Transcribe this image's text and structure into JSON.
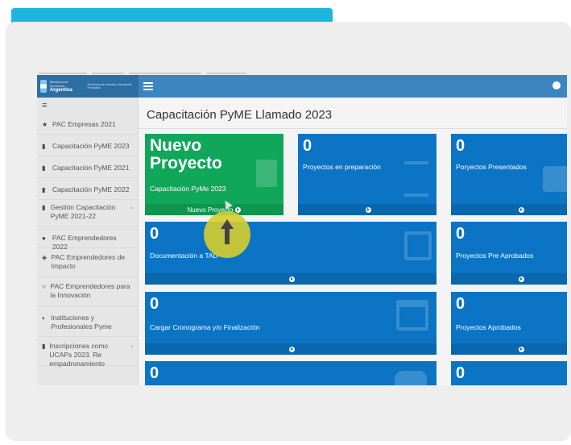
{
  "header": {
    "brand_line1": "Ministerio de Economía",
    "brand_line2": "Argentina",
    "brand_sub": "Secretaría de Industria y Desarrollo Productivo"
  },
  "sidebar": {
    "toggle": "≡",
    "items": [
      {
        "icon": "★",
        "label": "PAC Empresas 2021"
      },
      {
        "icon": "▮",
        "label": "Capacitación PyME 2023"
      },
      {
        "icon": "▮",
        "label": "Capacitación PyME 2021"
      },
      {
        "icon": "▮",
        "label": "Capacitación PyME 2022"
      },
      {
        "icon": "▮",
        "label": "Gestión Capacitación PyME 2021-22"
      },
      {
        "icon": "●",
        "label": "PAC Emprendedores 2022"
      },
      {
        "icon": "◈",
        "label": "PAC Emprendedores de Impacto"
      },
      {
        "icon": "○",
        "label": "PAC Emprendedores para la Innovación"
      },
      {
        "icon": "◐",
        "label": "Instituciones y Profesionales Pyme"
      },
      {
        "icon": "▮",
        "label": "Inscripciones como UCAPs 2023. Re empadronamiento"
      }
    ]
  },
  "main": {
    "title": "Capacitación PyME Llamado 2023",
    "new_project": {
      "title_line1": "Nuevo",
      "title_line2": "Proyecto",
      "subtitle": "Capacitación PyMe 2023",
      "footer": "Nuevo Proyecto"
    },
    "tiles": [
      {
        "count": "0",
        "label": "Proyectos en preparación"
      },
      {
        "count": "0",
        "label": "Poryectos Presentados"
      },
      {
        "count": "0",
        "label": "Documentación a TAD"
      },
      {
        "count": "0",
        "label": "Proyectos Pre Aprobados"
      },
      {
        "count": "0",
        "label": "Cargar Cronograma y/o Finalización"
      },
      {
        "count": "0",
        "label": "Proyectos Aprobados"
      },
      {
        "count": "0",
        "label": ""
      },
      {
        "count": "0",
        "label": ""
      }
    ]
  },
  "colors": {
    "accent_bar": "#1cb5e0",
    "tile_blue": "#0b74c4",
    "tile_green": "#10a75a",
    "header_blue": "#3d85c0",
    "cursor_highlight": "#d6cd2e"
  }
}
